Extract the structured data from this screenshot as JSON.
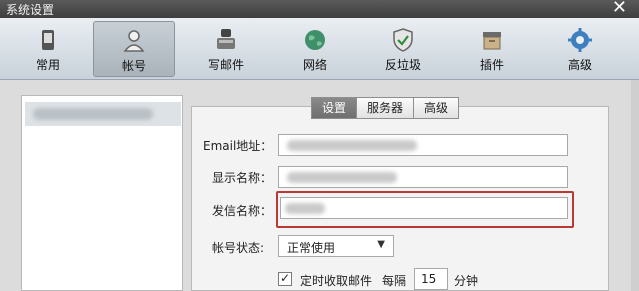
{
  "window": {
    "title": "系统设置",
    "close_glyph": "✕"
  },
  "toolbar": {
    "items": [
      {
        "label": "常用",
        "icon": "phone-device-icon"
      },
      {
        "label": "帐号",
        "icon": "user-account-icon",
        "selected": true
      },
      {
        "label": "写邮件",
        "icon": "write-mail-icon"
      },
      {
        "label": "网络",
        "icon": "globe-icon"
      },
      {
        "label": "反垃圾",
        "icon": "shield-check-icon"
      },
      {
        "label": "插件",
        "icon": "plugin-box-icon"
      },
      {
        "label": "高级",
        "icon": "gear-icon"
      }
    ]
  },
  "tabs": [
    {
      "label": "设置",
      "active": true
    },
    {
      "label": "服务器",
      "active": false
    },
    {
      "label": "高级",
      "active": false
    }
  ],
  "form": {
    "email_label": "Email地址：",
    "display_name_label": "显示名称：",
    "sender_name_label": "发信名称：",
    "status_label": "帐号状态:",
    "status_value": "正常使用",
    "auto_receive_label": "定时收取邮件",
    "interval_prefix": "每隔",
    "interval_value": "15",
    "interval_unit": "分钟"
  },
  "colors": {
    "highlight_border": "#b83a32",
    "active_tab": "#7a7a7a",
    "selected_tool": "#b4bcc3"
  }
}
